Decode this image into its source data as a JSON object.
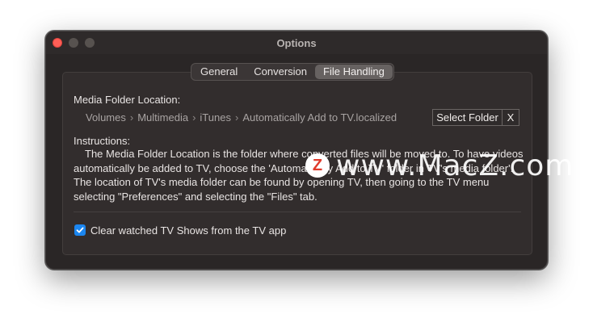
{
  "window": {
    "title": "Options"
  },
  "tabs": [
    {
      "label": "General",
      "active": false
    },
    {
      "label": "Conversion",
      "active": false
    },
    {
      "label": "File Handling",
      "active": true
    }
  ],
  "media_folder": {
    "label": "Media Folder Location:",
    "path": [
      "Volumes",
      "Multimedia",
      "iTunes",
      "Automatically Add to TV.localized"
    ],
    "path_separator": "›",
    "select_button": "Select Folder",
    "clear_button": "X"
  },
  "instructions": {
    "heading": "Instructions:",
    "body": "The Media Folder Location is the folder where converted files will be moved to. To have videos automatically be added to TV, choose the 'Automatically Add to TV' folder in TV's media folder'. The location of TV's media folder can be found by opening TV, then going to the TV menu selecting \"Preferences\" and selecting the \"Files\" tab."
  },
  "clear_watched": {
    "label": "Clear watched TV Shows from the TV app",
    "checked": true
  },
  "watermark": {
    "logo_letter": "Z",
    "text": "www.MacZ.com"
  },
  "colors": {
    "accent": "#1b86f0",
    "close_light": "#ff5f57",
    "window_bg": "#2a2626"
  }
}
